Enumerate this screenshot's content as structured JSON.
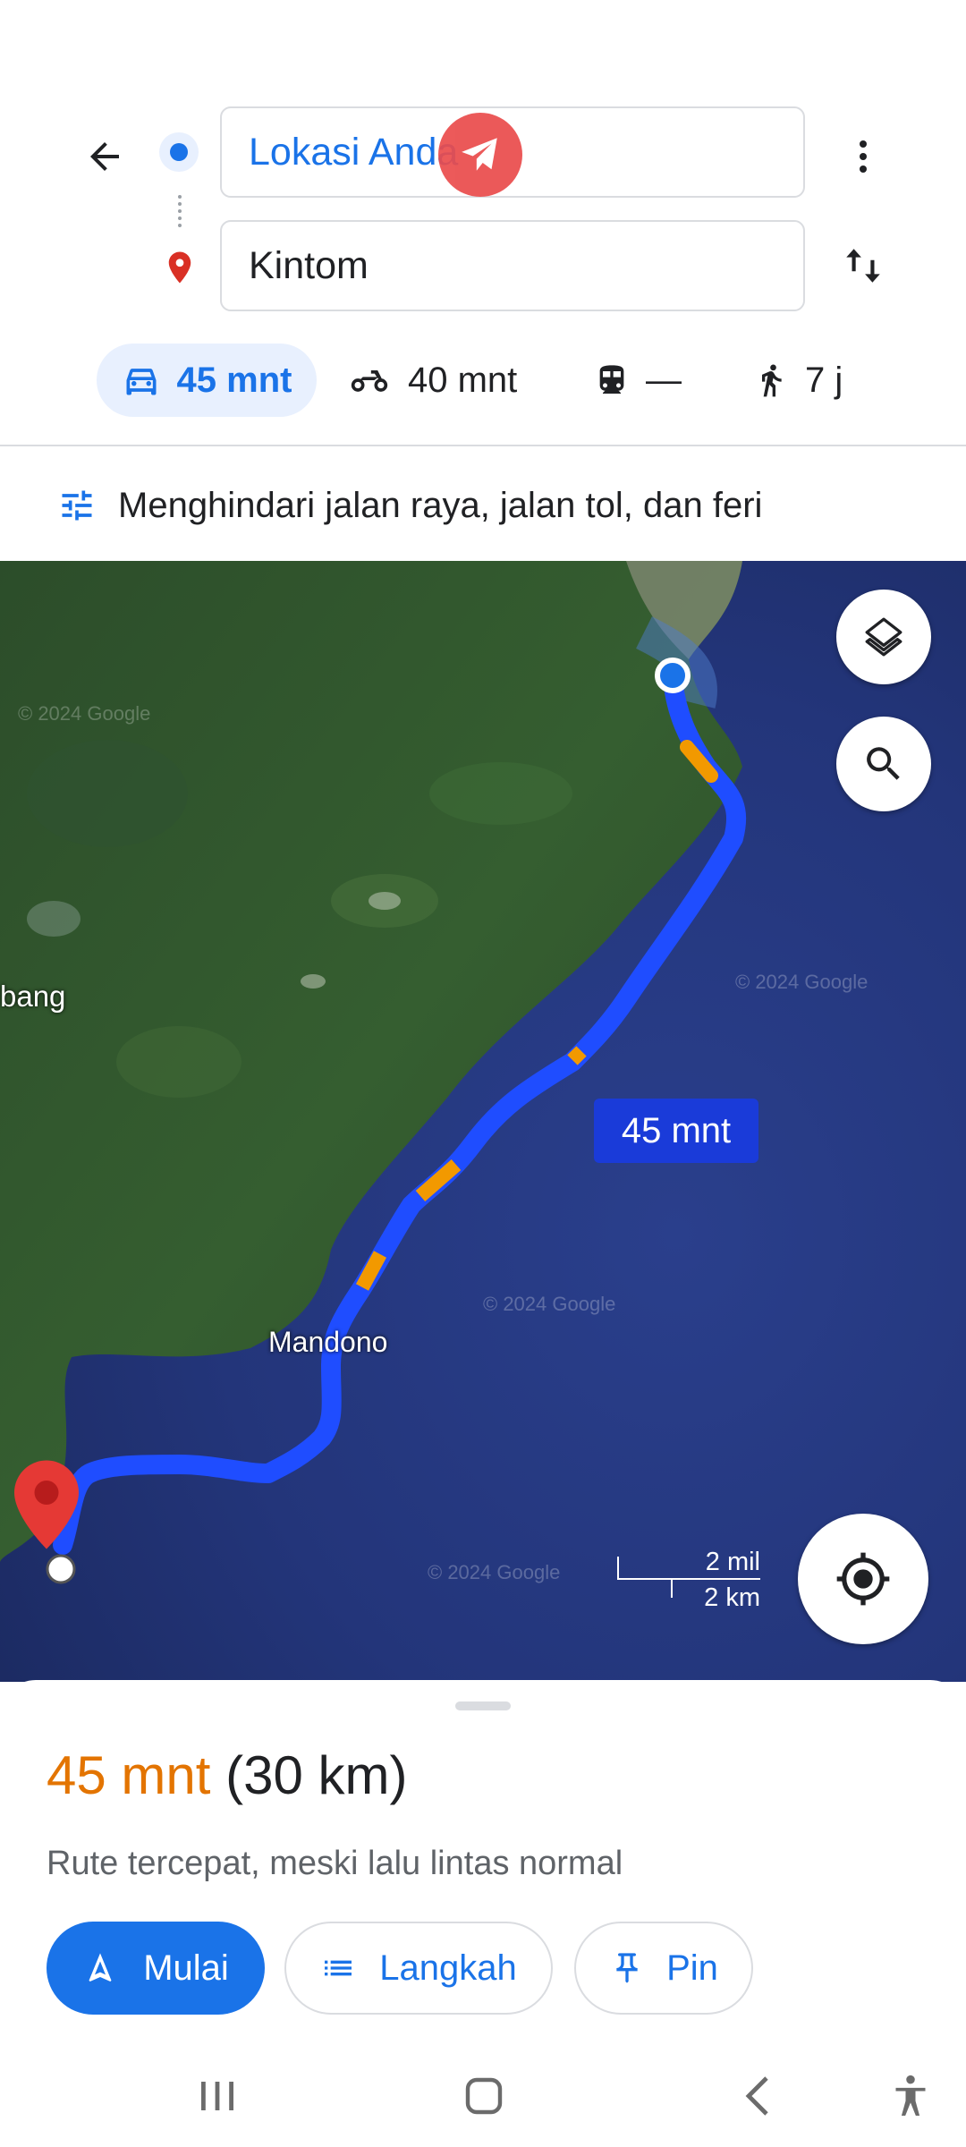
{
  "search": {
    "origin": "Lokasi Anda",
    "destination": "Kintom"
  },
  "modes": [
    {
      "name": "car",
      "label": "45 mnt"
    },
    {
      "name": "motorcycle",
      "label": "40 mnt"
    },
    {
      "name": "transit",
      "label": "—"
    },
    {
      "name": "walk",
      "label": "7 j"
    }
  ],
  "options_label": "Menghindari jalan raya, jalan tol, dan feri",
  "map": {
    "place_labels": [
      "bang",
      "Mandono"
    ],
    "watermark": "© 2024 Google",
    "route_time_label": "45 mnt",
    "scale_top": "2 mil",
    "scale_bottom": "2 km"
  },
  "summary": {
    "duration": "45 mnt",
    "distance": "(30 km)",
    "description": "Rute tercepat, meski lalu lintas normal"
  },
  "actions": {
    "start": "Mulai",
    "steps": "Langkah",
    "pin": "Pin"
  },
  "colors": {
    "accent": "#1a73e8",
    "duration_orange": "#e37400",
    "route_blue": "#1f4dff",
    "traffic_orange": "#f29900",
    "selected_mode_bg": "#e8f0fe",
    "telegram_badge": "#ea4c4c"
  },
  "icons": [
    "back-arrow-icon",
    "origin-dot-icon",
    "destination-pin-icon",
    "more-vert-icon",
    "swap-icon",
    "car-icon",
    "motorcycle-icon",
    "train-icon",
    "walk-icon",
    "tune-icon",
    "layers-icon",
    "search-icon",
    "my-location-icon",
    "navigation-icon",
    "list-icon",
    "pin-icon",
    "recent-apps-icon",
    "home-icon",
    "back-icon",
    "accessibility-icon"
  ]
}
